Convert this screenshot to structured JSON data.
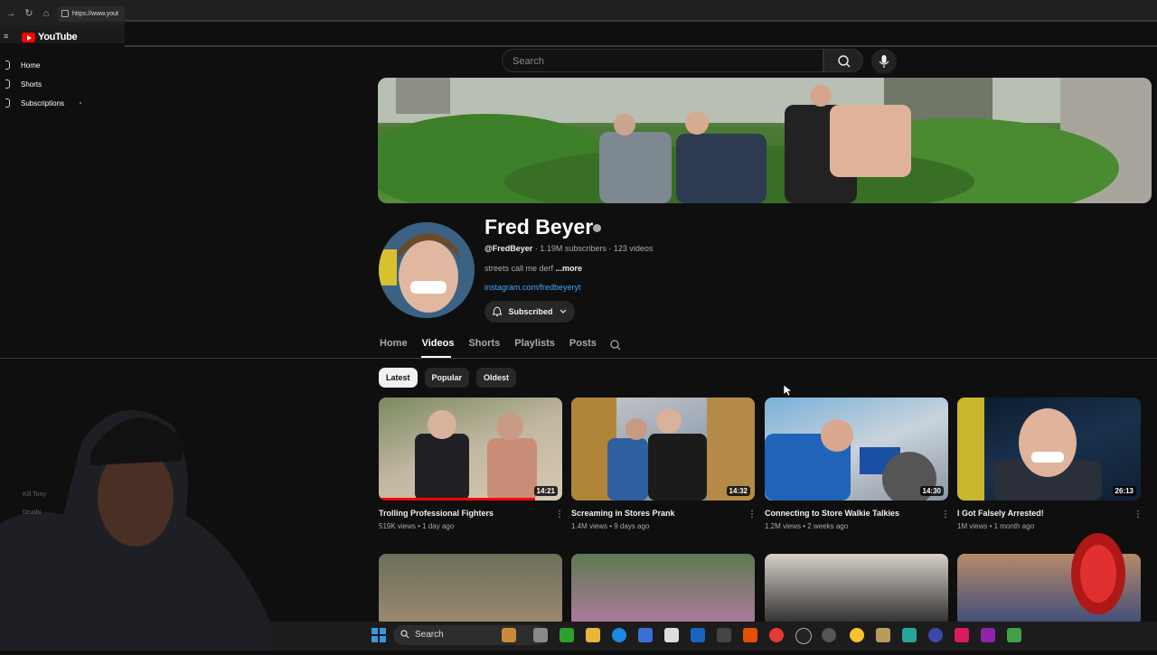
{
  "browser": {
    "url": "https://www.yout"
  },
  "sidebar": {
    "logo_text": "YouTube",
    "items": [
      {
        "label": "Home"
      },
      {
        "label": "Shorts"
      },
      {
        "label": "Subscriptions"
      }
    ]
  },
  "search": {
    "placeholder": "Search"
  },
  "channel": {
    "name": "Fred Beyer",
    "handle": "@FredBeyer",
    "stats": "· 1.19M subscribers · 123 videos",
    "description": "streets call me derf",
    "more_label": "...more",
    "link": "instagram.com/fredbeyeryt",
    "subscribe_label": "Subscribed"
  },
  "tabs": {
    "items": [
      "Home",
      "Videos",
      "Shorts",
      "Playlists",
      "Posts"
    ],
    "active": "Videos"
  },
  "filters": {
    "items": [
      "Latest",
      "Popular",
      "Oldest"
    ],
    "active": "Latest"
  },
  "videos": [
    {
      "title": "Trolling Professional Fighters",
      "meta": "519K views • 1 day ago",
      "duration": "14:21",
      "progress": 0.85
    },
    {
      "title": "Screaming in Stores Prank",
      "meta": "1.4M views • 9 days ago",
      "duration": "14:32",
      "progress": 0
    },
    {
      "title": "Connecting to Store Walkie Talkies",
      "meta": "1.2M views • 2 weeks ago",
      "duration": "14:30",
      "progress": 0
    },
    {
      "title": "I Got Falsely Arrested!",
      "meta": "1M views • 1 month ago",
      "duration": "26:13",
      "progress": 0
    }
  ],
  "taskbar": {
    "search_label": "Search"
  },
  "overlay": {
    "ghost_items": [
      "Kill Tony",
      "Drushi"
    ]
  },
  "colors": {
    "accent": "#ff0000",
    "link": "#3ea6ff",
    "background": "#0f0f0f"
  }
}
